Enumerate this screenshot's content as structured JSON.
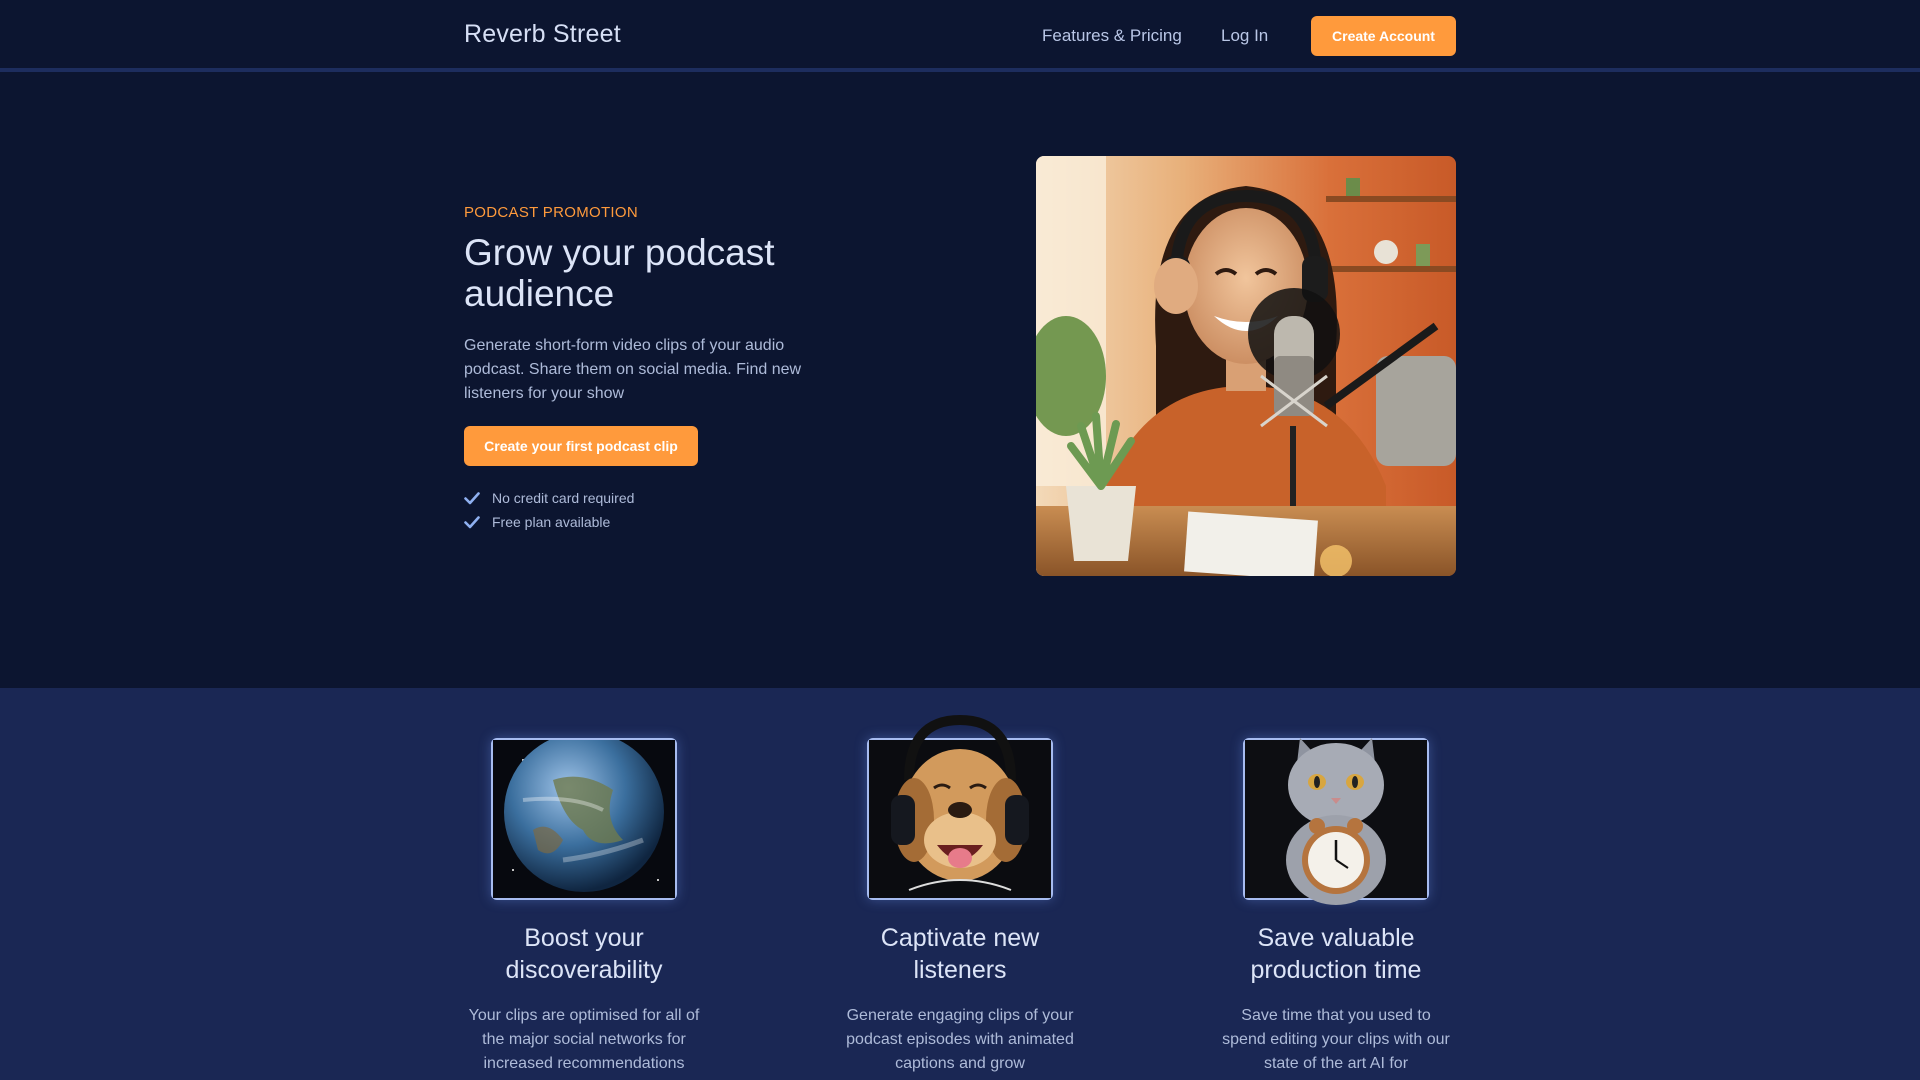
{
  "header": {
    "brand": "Reverb Street",
    "nav": {
      "features_pricing": "Features & Pricing",
      "login": "Log In"
    },
    "create_account": "Create Account"
  },
  "hero": {
    "eyebrow": "PODCAST PROMOTION",
    "title": "Grow your podcast audience",
    "description": "Generate short-form video clips of your audio podcast. Share them on social media. Find new listeners for your show",
    "cta": "Create your first podcast clip",
    "checks": [
      "No credit card required",
      "Free plan available"
    ],
    "image_icon": "podcaster-photo"
  },
  "features": [
    {
      "icon": "earth-image",
      "title": "Boost your discoverability",
      "description": "Your clips are optimised for all of the major social networks for increased recommendations"
    },
    {
      "icon": "dog-headphones-image",
      "title": "Captivate new listeners",
      "description": "Generate engaging clips of your podcast episodes with animated captions and grow"
    },
    {
      "icon": "cat-clock-image",
      "title": "Save valuable production time",
      "description": "Save time that you used to spend editing your clips with our state of the art AI for"
    }
  ],
  "colors": {
    "accent": "#ff9a3c",
    "background": "#0c1530",
    "features_background": "#1a2754"
  }
}
